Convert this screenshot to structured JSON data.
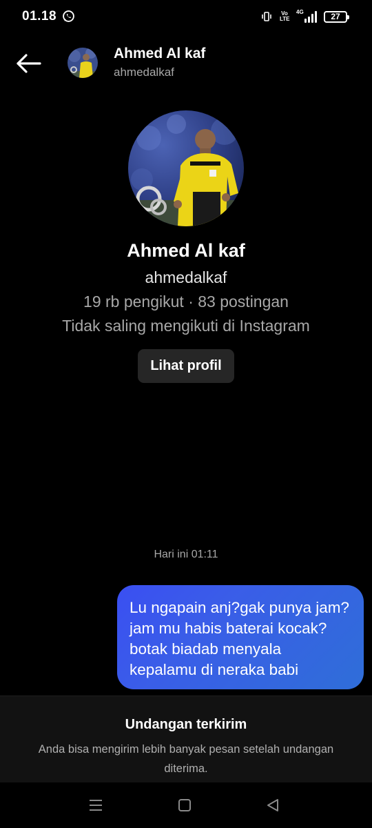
{
  "status_bar": {
    "time": "01.18",
    "notification_icon": "whatsapp-icon",
    "network_label": "4G",
    "volte_label_top": "Vo",
    "volte_label_bottom": "LTE",
    "battery_level": "27"
  },
  "header": {
    "name": "Ahmed Al kaf",
    "username": "ahmedalkaf"
  },
  "profile": {
    "name": "Ahmed Al kaf",
    "username": "ahmedalkaf",
    "stats": "19 rb pengikut · 83 postingan",
    "relation": "Tidak saling mengikuti di Instagram",
    "view_profile_label": "Lihat profil"
  },
  "thread": {
    "timestamp": "Hari ini 01:11",
    "message": "Lu ngapain anj?gak punya jam?jam mu habis baterai kocak?botak biadab menyala kepalamu di neraka babi"
  },
  "notice": {
    "title": "Undangan terkirim",
    "body": "Anda bisa mengirim lebih banyak pesan setelah undangan diterima."
  },
  "colors": {
    "background": "#000000",
    "bubble_start": "#3a4ff2",
    "bubble_end": "#2f6ed8",
    "button_bg": "#262626",
    "notice_bg": "#121212",
    "secondary_text": "#a8a8a8"
  }
}
